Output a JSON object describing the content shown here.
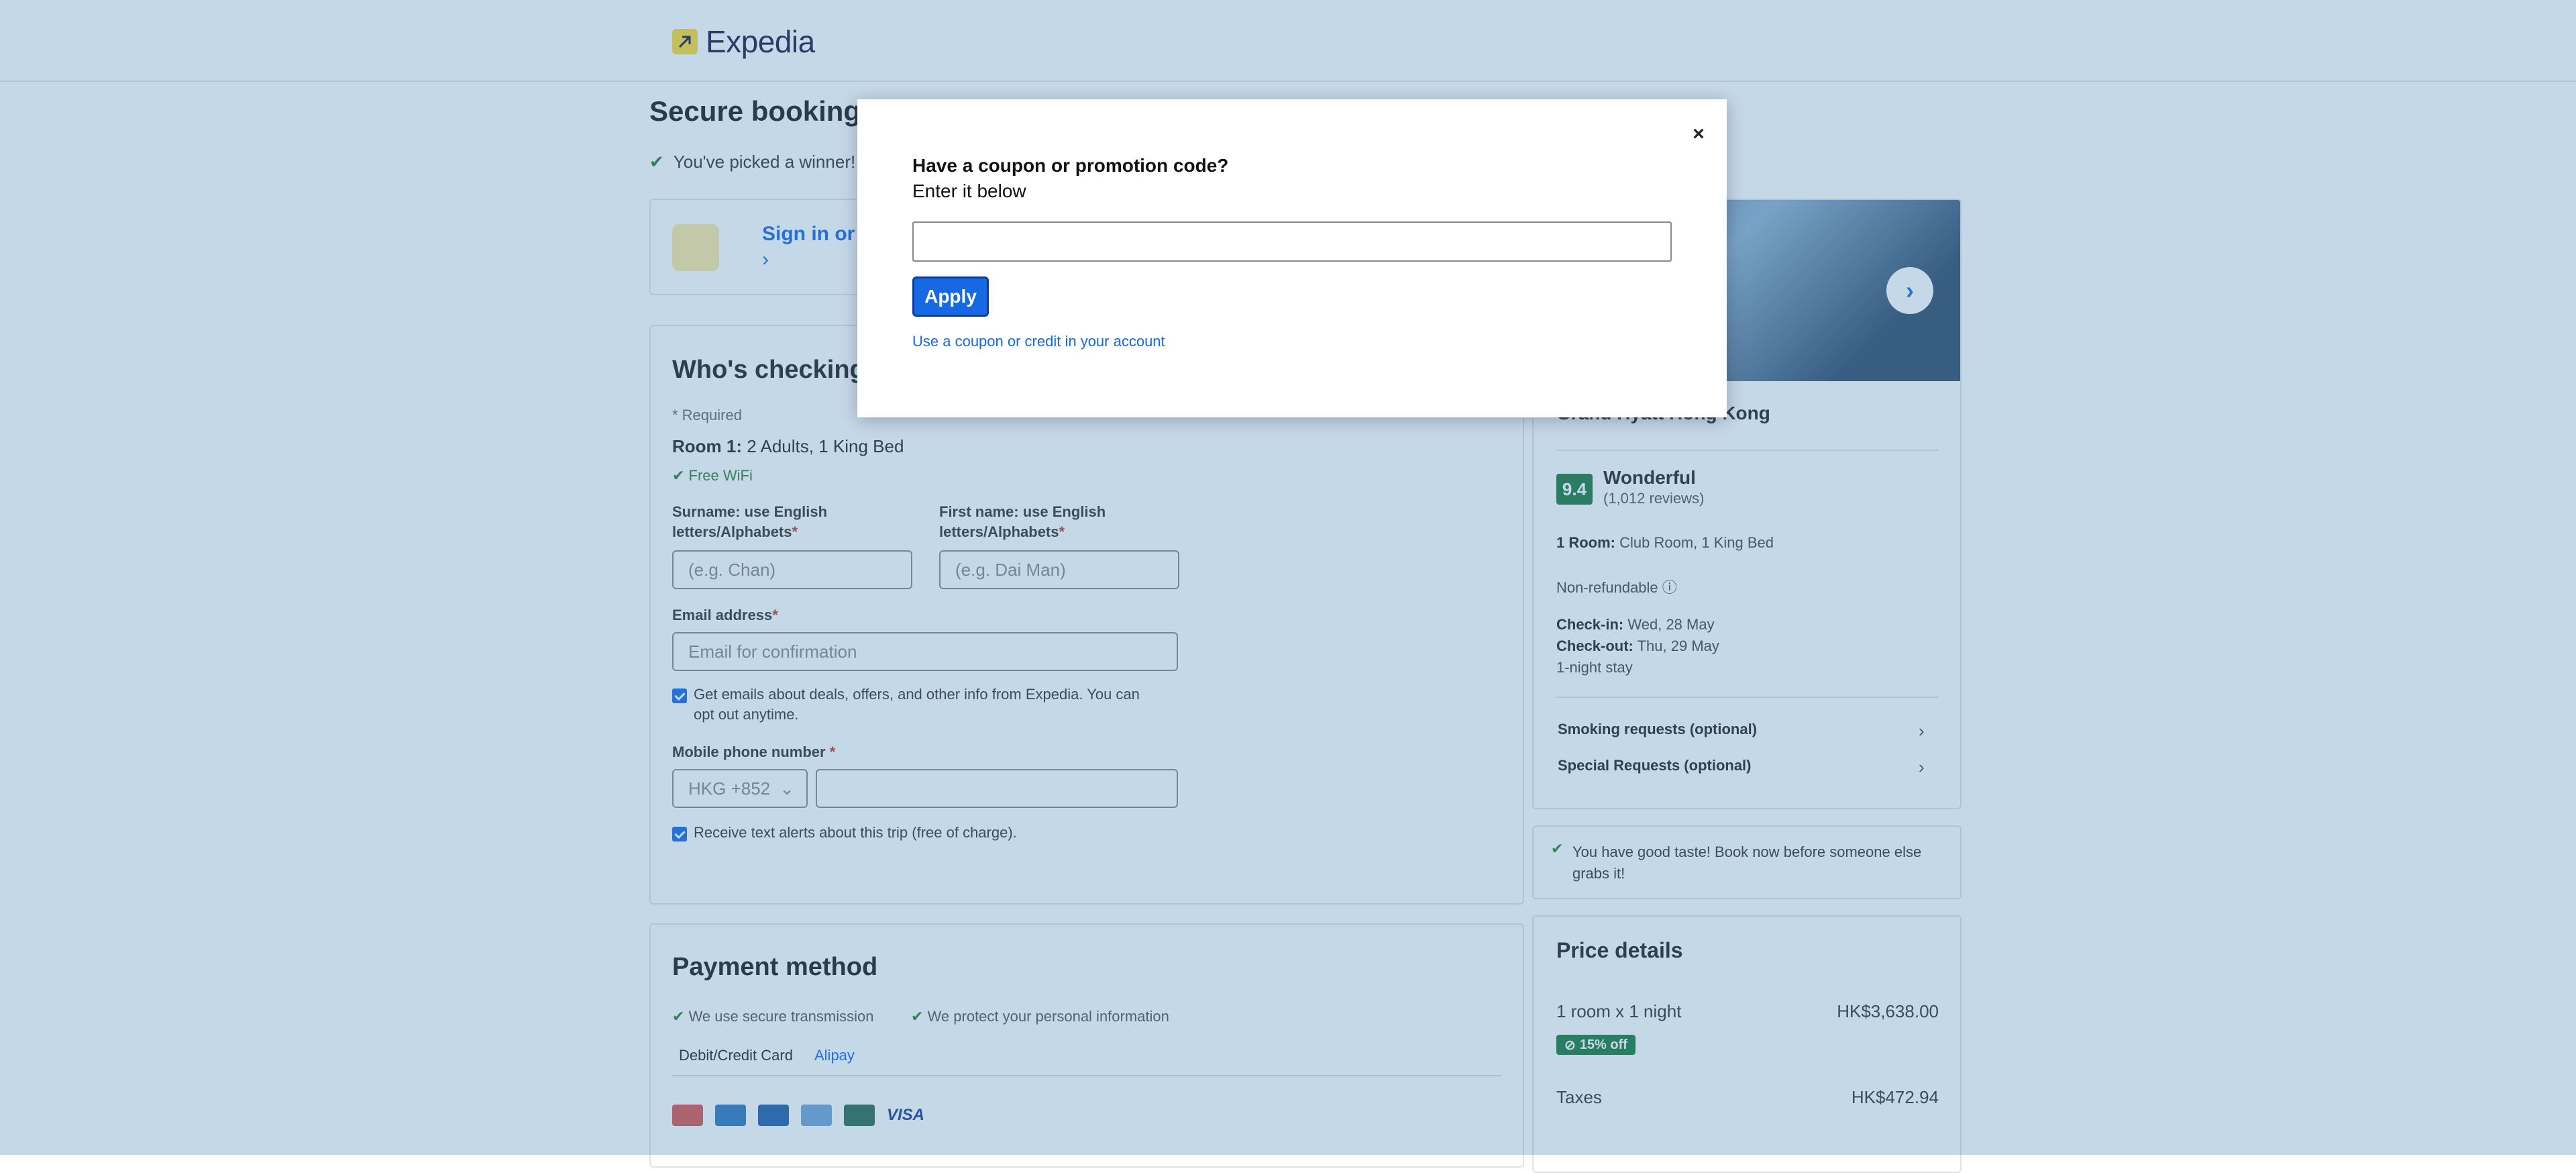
{
  "brand": {
    "name": "Expedia",
    "logo_icon": "arrow-icon"
  },
  "page": {
    "title": "Secure booking",
    "picked_text": "You've picked a winner!",
    "signin": {
      "label": "Sign in or",
      "chevron": "›"
    }
  },
  "who": {
    "title": "Who's checking",
    "required_note": "* Required",
    "room_label": "Room 1:",
    "room_value": "2 Adults, 1 King Bed",
    "wifi": "Free WiFi",
    "surname_label_1": "Surname: use English",
    "surname_label_2": "letters/Alphabets",
    "surname_placeholder": "(e.g. Chan)",
    "firstname_label_1": "First name: use English",
    "firstname_label_2": "letters/Alphabets",
    "firstname_placeholder": "(e.g. Dai Man)",
    "email_label": "Email address",
    "email_placeholder": "Email for confirmation",
    "deals_text_1": "Get emails about deals, offers, and other info from Expedia. You can",
    "deals_text_2": "opt out anytime.",
    "phone_label": "Mobile phone number",
    "phone_code": "HKG +852",
    "text_alerts": "Receive text alerts about this trip (free of charge).",
    "asterisk": "*"
  },
  "payment": {
    "title": "Payment method",
    "secure_1": "We use secure transmission",
    "secure_2": "We protect your personal information",
    "tab_card": "Debit/Credit Card",
    "tab_alipay": "Alipay",
    "visa": "VISA"
  },
  "hotel": {
    "name": "Grand Hyatt Hong Kong",
    "score": "9.4",
    "score_word": "Wonderful",
    "reviews": "(1,012 reviews)",
    "room_label": "1 Room:",
    "room_value": "Club Room, 1 King Bed",
    "refund": "Non-refundable",
    "checkin_label": "Check-in:",
    "checkin_value": "Wed, 28 May",
    "checkout_label": "Check-out:",
    "checkout_value": "Thu, 29 May",
    "stay": "1-night stay",
    "smoking": "Smoking requests (optional)",
    "special": "Special Requests (optional)"
  },
  "taste": "You have good taste! Book now before someone else grabs it!",
  "price": {
    "title": "Price details",
    "row1_label": "1 room x 1 night",
    "row1_value": "HK$3,638.00",
    "discount": "15% off",
    "taxes_label": "Taxes",
    "taxes_value": "HK$472.94"
  },
  "modal": {
    "title_line1": "Have a coupon or promotion code?",
    "title_line2": "Enter it below",
    "input_value": "",
    "apply_label": "Apply",
    "account_link": "Use a coupon or credit in your account",
    "close_icon": "×"
  }
}
